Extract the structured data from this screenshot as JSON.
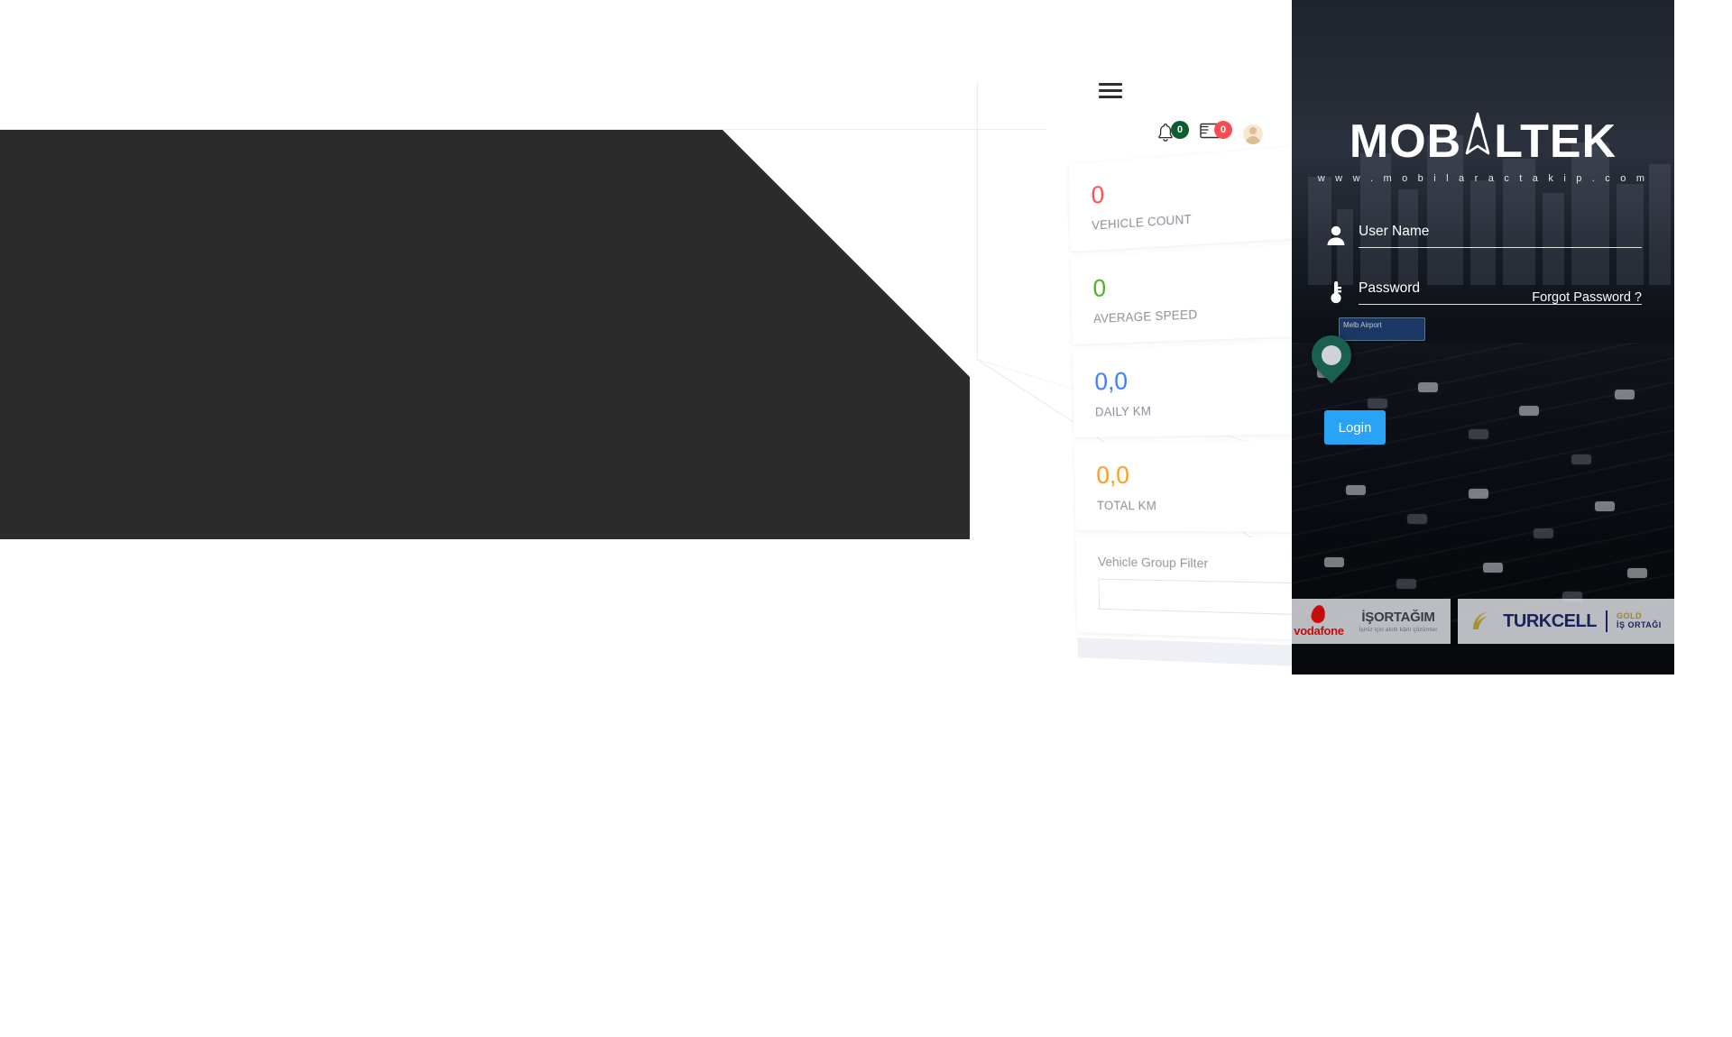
{
  "dashboard": {
    "menu_icon": "hamburger-menu-icon",
    "header_icons": [
      {
        "name": "notification-bell-icon",
        "badge": "0",
        "badge_color": "#0b5d33"
      },
      {
        "name": "message-envelope-icon",
        "badge": "0",
        "badge_color": "#fc4b52"
      },
      {
        "name": "user-avatar",
        "badge": "",
        "badge_color": ""
      }
    ],
    "stats": [
      {
        "value": "0",
        "label": "VEHICLE COUNT",
        "color": "#ff4d4f"
      },
      {
        "value": "0",
        "label": "AVERAGE SPEED",
        "color": "#4caf2a"
      },
      {
        "value": "0,0",
        "label": "DAILY KM",
        "color": "#3d7bff"
      },
      {
        "value": "0,0",
        "label": "TOTAL KM",
        "color": "#ff9a1f"
      }
    ],
    "filter": {
      "label": "Vehicle Group Filter",
      "value": "",
      "placeholder": ""
    }
  },
  "login": {
    "logo": {
      "text_left": "MOB",
      "mark": "compass-arrow-icon",
      "text_right": "LTEK",
      "url": "w w w . m o b i l a r a c t a k i p . c o m"
    },
    "username": {
      "icon": "user-icon",
      "value": "",
      "placeholder": "User Name"
    },
    "password": {
      "icon": "key-icon",
      "value": "",
      "placeholder": "Password"
    },
    "forgot_label": "Forgot Password ?",
    "login_label": "Login",
    "accent_color": "#29a3f5"
  },
  "partners": [
    {
      "name": "vodafone",
      "text": "vodafone"
    },
    {
      "name": "isortagim",
      "text": "İŞORTAĞIM",
      "subtitle": "İşiniz için akıllı kârlı çözümler"
    },
    {
      "name": "turkcell",
      "text": "TURKCELL",
      "tag_line1": "GOLD",
      "tag_line2": "İŞ ORTAĞI"
    }
  ]
}
